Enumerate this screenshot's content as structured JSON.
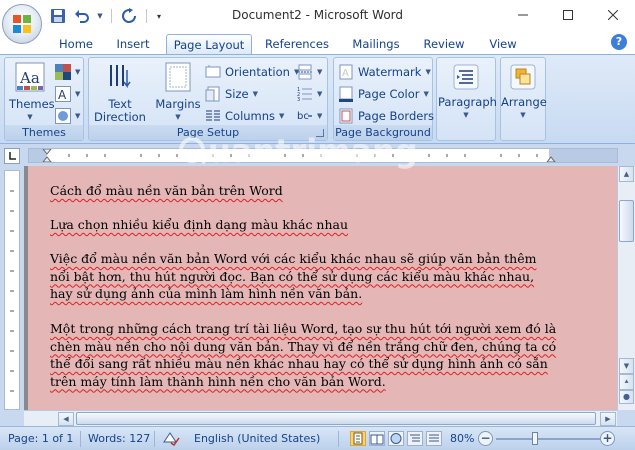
{
  "window": {
    "title": "Document2 - Microsoft Word"
  },
  "tabs": [
    "Home",
    "Insert",
    "Page Layout",
    "References",
    "Mailings",
    "Review",
    "View"
  ],
  "active_tab": "Page Layout",
  "ribbon": {
    "themes": {
      "button": "Themes",
      "group": "Themes"
    },
    "page_setup": {
      "text_direction_line1": "Text",
      "text_direction_line2": "Direction",
      "margins": "Margins",
      "orientation": "Orientation",
      "size": "Size",
      "columns": "Columns",
      "group": "Page Setup"
    },
    "page_background": {
      "watermark": "Watermark",
      "page_color": "Page Color",
      "page_borders": "Page Borders",
      "group": "Page Background"
    },
    "paragraph": "Paragraph",
    "arrange": "Arrange"
  },
  "document": {
    "paragraphs": [
      "Cách đổ màu nền văn bản trên Word",
      "Lựa chọn nhiều kiểu định dạng màu khác nhau",
      "Việc đổ màu nền văn bản Word với các kiểu khác nhau sẽ giúp văn bản thêm nổi bật hơn, thu hút người đọc. Bạn có thể sử dụng các kiểu màu khác nhau, hay sử dụng ảnh của mình làm hình nền văn bản.",
      "Một trong những cách trang trí tài liệu Word, tạo sự thu hút tới người xem đó là chèn màu nền cho nội dung văn bản. Thay vì để nền trắng chữ đen, chúng ta có thể đổi sang rất nhiều màu nền khác nhau hay có thể sử dụng hình ảnh có sẵn trên máy tính làm thành hình nền cho văn bản Word."
    ],
    "page_color": "#e5b6b6"
  },
  "status": {
    "page": "Page: 1 of 1",
    "words": "Words: 127",
    "language": "English (United States)",
    "zoom": "80%"
  },
  "watermark_text": "uantrimang"
}
